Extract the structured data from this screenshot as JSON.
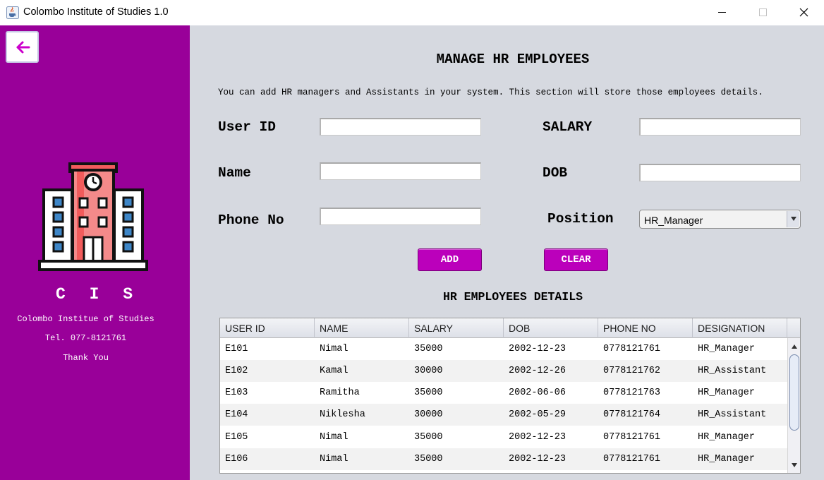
{
  "window": {
    "title": "Colombo Institute of Studies 1.0"
  },
  "sidebar": {
    "brand": "C I S",
    "institute_name": "Colombo Institue of Studies",
    "telephone": "Tel. 077-8121761",
    "thanks": "Thank You"
  },
  "main": {
    "title": "MANAGE HR EMPLOYEES",
    "description": "You can add HR managers and Assistants in your system. This section will store those employees details.",
    "form": {
      "user_id_label": "User ID",
      "user_id_value": "",
      "name_label": "Name",
      "name_value": "",
      "phone_label": "Phone No",
      "phone_value": "",
      "salary_label": "SALARY",
      "salary_value": "",
      "dob_label": "DOB",
      "dob_value": "",
      "position_label": "Position",
      "position_value": "HR_Manager"
    },
    "buttons": {
      "add": "ADD",
      "clear": "CLEAR"
    },
    "table_title": "HR EMPLOYEES DETAILS"
  },
  "table": {
    "columns": [
      "USER ID",
      "NAME",
      "SALARY",
      "DOB",
      "PHONE NO",
      "DESIGNATION"
    ],
    "rows": [
      [
        "E101",
        "Nimal",
        "35000",
        "2002-12-23",
        "0778121761",
        "HR_Manager"
      ],
      [
        "E102",
        "Kamal",
        "30000",
        "2002-12-26",
        "0778121762",
        "HR_Assistant"
      ],
      [
        "E103",
        "Ramitha",
        "35000",
        "2002-06-06",
        "0778121763",
        "HR_Manager"
      ],
      [
        "E104",
        "Niklesha",
        "30000",
        "2002-05-29",
        "0778121764",
        "HR_Assistant"
      ],
      [
        "E105",
        "Nimal",
        "35000",
        "2002-12-23",
        "0778121761",
        "HR_Manager"
      ],
      [
        "E106",
        "Nimal",
        "35000",
        "2002-12-23",
        "0778121761",
        "HR_Manager"
      ]
    ]
  },
  "colors": {
    "sidebar": "#990099",
    "button": "#bb00bb",
    "background": "#d6d9e0"
  },
  "icons": {
    "app": "java-coffee-cup-icon",
    "back": "arrow-left-icon",
    "logo": "building-icon"
  }
}
